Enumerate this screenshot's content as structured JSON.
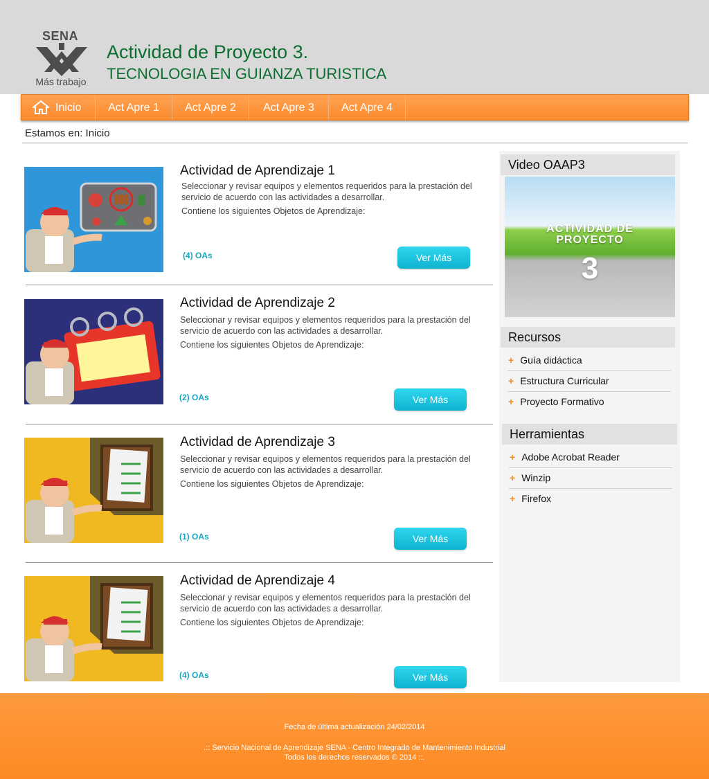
{
  "header": {
    "logo_word": "SENA",
    "logo_sub": "Más trabajo",
    "title": "Actividad de Proyecto 3.",
    "subtitle": "TECNOLOGIA EN GUIANZA TURISTICA"
  },
  "nav": {
    "items": [
      {
        "label": "Inicio",
        "icon": "home-icon"
      },
      {
        "label": "Act Apre 1"
      },
      {
        "label": "Act Apre 2"
      },
      {
        "label": "Act Apre 3"
      },
      {
        "label": "Act Apre 4"
      }
    ]
  },
  "breadcrumb": "Estamos en: Inicio",
  "activities": [
    {
      "title": "Actividad de Aprendizaje 1",
      "description": "Seleccionar y revisar equipos y elementos requeridos para la prestación del servicio de acuerdo con las actividades a desarrollar.",
      "objects_text": "Contiene los siguientes Objetos de Aprendizaje:",
      "oas": "(4)  OAs",
      "button": "Ver Más",
      "illustration": "guide-with-equipment-board"
    },
    {
      "title": "Actividad de Aprendizaje 2",
      "description": "Seleccionar y revisar equipos y elementos requeridos para la prestación del servicio de acuerdo con las actividades a desarrollar.",
      "objects_text": "Contiene los siguientes Objetos de Aprendizaje:",
      "oas": "(2)  OAs",
      "button": "Ver Más",
      "illustration": "guide-with-calendar"
    },
    {
      "title": "Actividad de Aprendizaje 3",
      "description": "Seleccionar y revisar equipos y elementos requeridos para la prestación del servicio de acuerdo con las actividades a desarrollar.",
      "objects_text": "Contiene los siguientes Objetos de Aprendizaje:",
      "oas": "(1)  OAs",
      "button": "Ver Más",
      "illustration": "guide-with-checklist"
    },
    {
      "title": "Actividad de Aprendizaje 4",
      "description": "Seleccionar y revisar equipos y elementos requeridos para la prestación del servicio de acuerdo con las actividades a desarrollar.",
      "objects_text": "Contiene los siguientes Objetos de Aprendizaje:",
      "oas": "(4)  OAs",
      "button": "Ver Más",
      "illustration": "guide-with-checklist"
    }
  ],
  "sidebar": {
    "video_title": "Video OAAP3",
    "video_caption_line1": "ACTIVIDAD DE",
    "video_caption_line2": "PROYECTO",
    "video_number": "3",
    "resources_title": "Recursos",
    "resources": [
      "Guía didáctica",
      "Estructura Curricular",
      "Proyecto Formativo"
    ],
    "tools_title": "Herramientas",
    "tools": [
      "Adobe Acrobat Reader",
      "Winzip",
      "Firefox"
    ]
  },
  "footer": {
    "updated": "Fecha de última actualización 24/02/2014",
    "line1": ".:: Servicio Nacional de Aprendizaje SENA - Centro Integrado de Mantenimiento Industrial",
    "line2": "Todos los derechos reservados © 2014 ::."
  },
  "colors": {
    "brand_green": "#0b6d2f",
    "nav_orange": "#fb8a2e",
    "button_cyan": "#10b3d0",
    "footer_orange": "#fc8a22"
  }
}
